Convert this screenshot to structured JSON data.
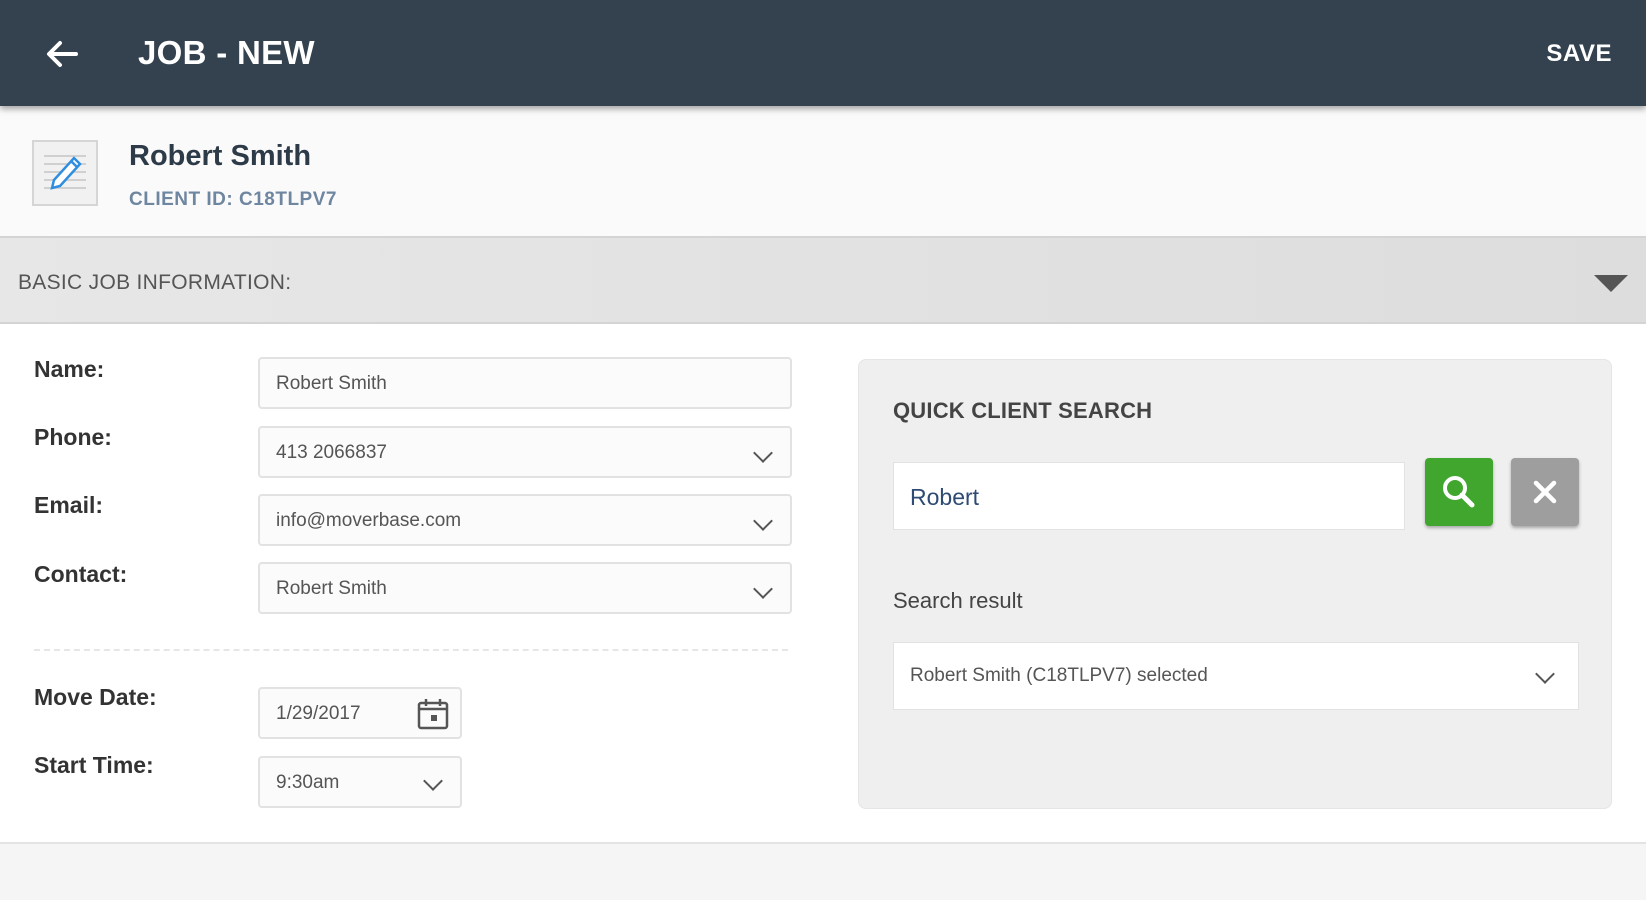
{
  "appbar": {
    "title": "JOB - NEW",
    "save_label": "SAVE",
    "back_icon": "arrow-left-icon",
    "background": "#34414f"
  },
  "client": {
    "name": "Robert Smith",
    "client_id_label": "CLIENT ID: C18TLPV7",
    "icon": "edit-document-icon"
  },
  "section": {
    "title": "BASIC JOB INFORMATION:",
    "expanded": true
  },
  "form": {
    "name_label": "Name:",
    "name_value": "Robert Smith",
    "phone_label": "Phone:",
    "phone_value": "413 2066837",
    "email_label": "Email:",
    "email_value": "info@moverbase.com",
    "contact_label": "Contact:",
    "contact_value": "Robert Smith",
    "move_date_label": "Move Date:",
    "move_date_value": "1/29/2017",
    "start_time_label": "Start Time:",
    "start_time_value": "9:30am"
  },
  "quick_search": {
    "title": "QUICK CLIENT SEARCH",
    "query": "Robert",
    "search_button_color": "#40a62d",
    "clear_button_color": "#9e9e9e",
    "result_label": "Search result",
    "result_value": "Robert Smith (C18TLPV7) selected"
  }
}
